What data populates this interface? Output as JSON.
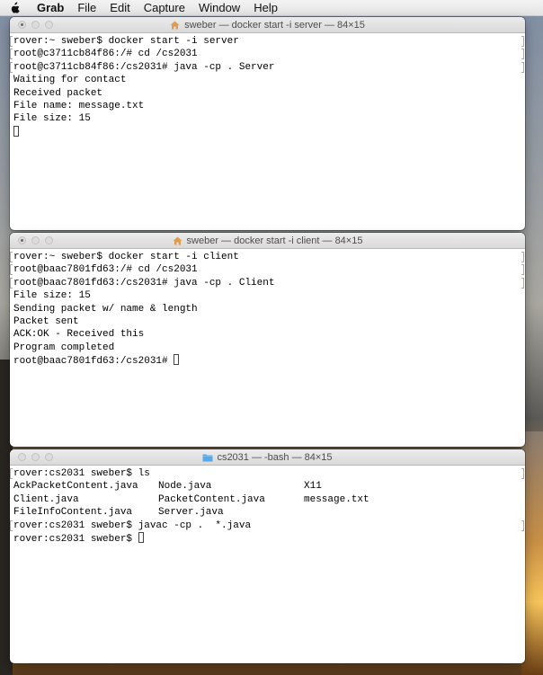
{
  "menubar": {
    "app": "Grab",
    "items": [
      "File",
      "Edit",
      "Capture",
      "Window",
      "Help"
    ]
  },
  "windows": {
    "server": {
      "title": "sweber — docker start -i server — 84×15",
      "lines": [
        "rover:~ sweber$ docker start -i server",
        "root@c3711cb84f86:/# cd /cs2031",
        "root@c3711cb84f86:/cs2031# java -cp . Server",
        "Waiting for contact",
        "Received packet",
        "File name: message.txt",
        "File size: 15"
      ]
    },
    "client": {
      "title": "sweber — docker start -i client — 84×15",
      "lines": [
        "rover:~ sweber$ docker start -i client",
        "root@baac7801fd63:/# cd /cs2031",
        "root@baac7801fd63:/cs2031# java -cp . Client",
        "File size: 15",
        "Sending packet w/ name & length",
        "Packet sent",
        "ACK:OK - Received this",
        "Program completed"
      ],
      "prompt": "root@baac7801fd63:/cs2031# "
    },
    "bash": {
      "title": "cs2031 — -bash — 84×15",
      "command1": "rover:cs2031 sweber$ ls",
      "files": [
        [
          "AckPacketContent.java",
          "Node.java",
          "X11"
        ],
        [
          "Client.java",
          "PacketContent.java",
          "message.txt"
        ],
        [
          "FileInfoContent.java",
          "Server.java",
          ""
        ]
      ],
      "command2": "rover:cs2031 sweber$ javac -cp .  *.java",
      "prompt": "rover:cs2031 sweber$ "
    }
  },
  "colors": {
    "folder": "#5aa7e6",
    "home": "#e09b4e"
  }
}
